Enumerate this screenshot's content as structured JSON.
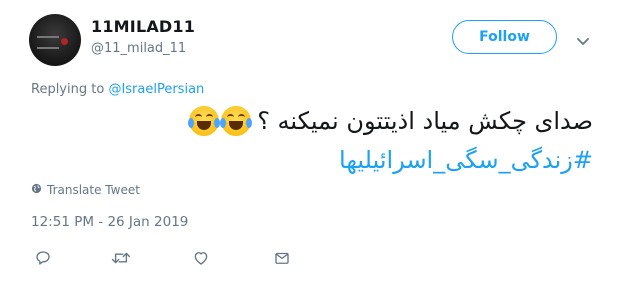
{
  "user": {
    "display_name": "11MILAD11",
    "handle": "@11_milad_11",
    "avatar_icon": "avatar-image"
  },
  "header": {
    "follow_label": "Follow",
    "more_icon": "chevron-down-icon"
  },
  "reply": {
    "prefix": "Replying to",
    "target": "@IsraelPersian"
  },
  "tweet": {
    "text": "صدای چکش میاد اذیتتون نمیکنه ؟",
    "emojis": [
      "face-with-tears-of-joy",
      "face-with-tears-of-joy"
    ],
    "hashtag": "#زندگی_سگی_اسرائیلیها"
  },
  "translate": {
    "label": "Translate Tweet",
    "icon": "globe-icon"
  },
  "meta": {
    "timestamp": "12:51 PM - 26 Jan 2019"
  },
  "actions": {
    "icons": [
      "reply-icon",
      "retweet-icon",
      "like-icon",
      "direct-message-icon"
    ]
  },
  "colors": {
    "accent": "#1da1f2",
    "secondary_text": "#657786",
    "primary_text": "#14171a"
  }
}
